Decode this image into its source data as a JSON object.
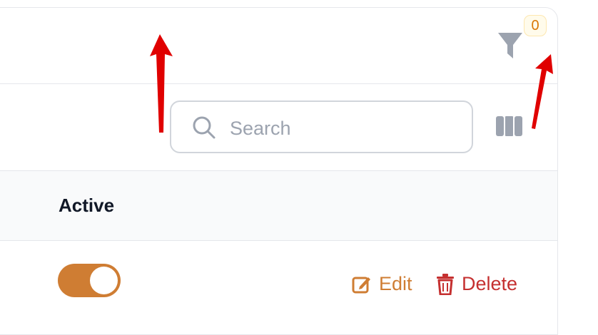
{
  "filter": {
    "icon": "funnel-icon",
    "badge_count": "0"
  },
  "search": {
    "placeholder": "Search",
    "value": ""
  },
  "columns_toggle": {
    "icon": "columns-icon"
  },
  "table": {
    "headers": [
      "Active"
    ],
    "rows": [
      {
        "active": true,
        "actions": {
          "edit_label": "Edit",
          "delete_label": "Delete"
        }
      }
    ]
  },
  "colors": {
    "accent": "#cf7d33",
    "danger": "#c53030",
    "badge_text": "#d97706",
    "annotation_arrow": "#e00000"
  }
}
